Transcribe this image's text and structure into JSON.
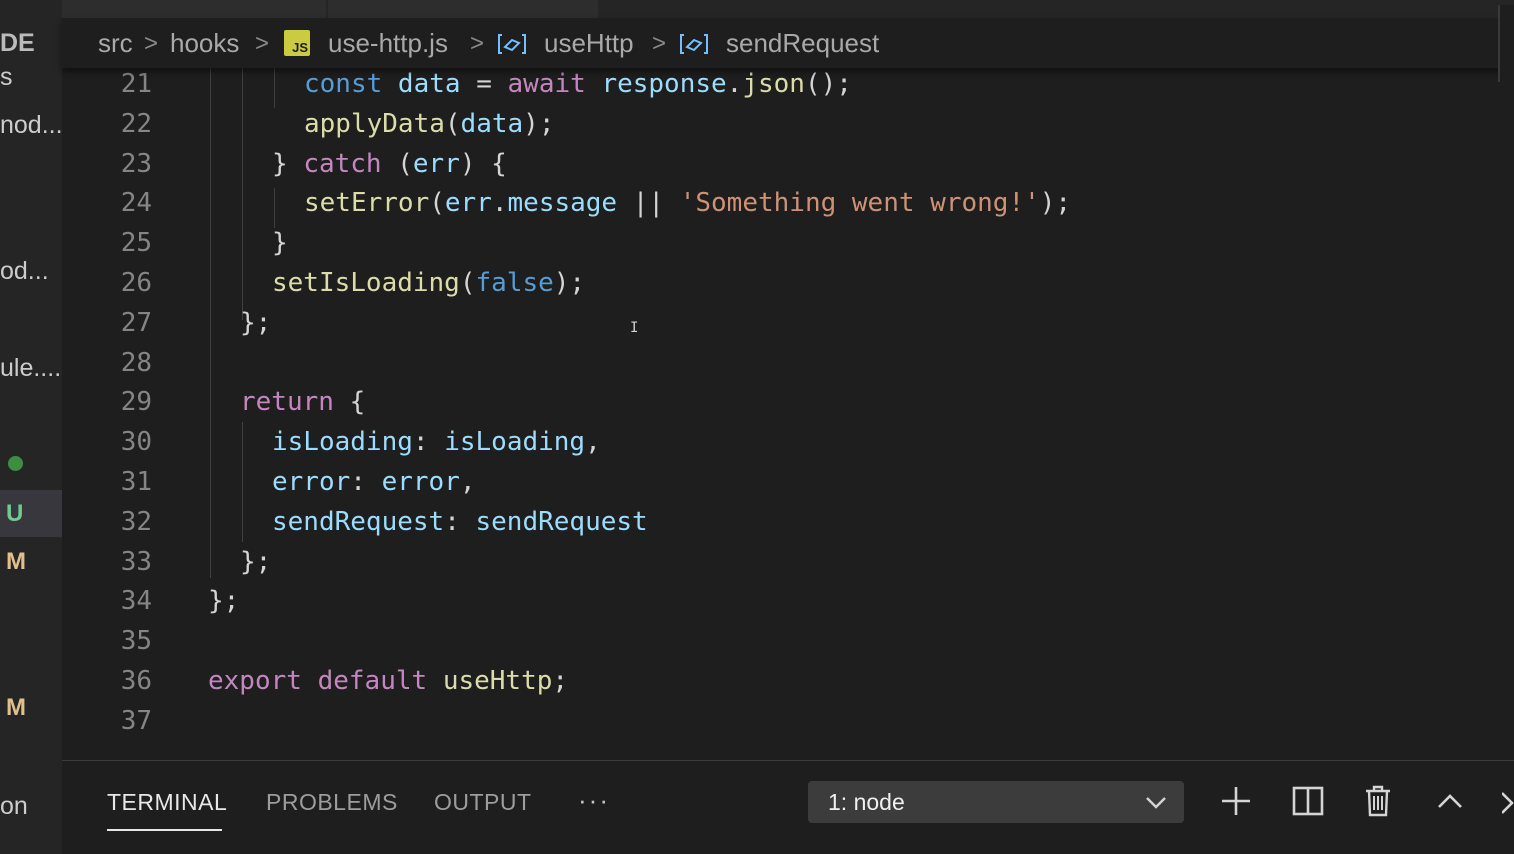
{
  "sidebar": {
    "title": "DE",
    "items": [
      {
        "text": "s"
      },
      {
        "text": "nod..."
      },
      {
        "text": "od..."
      },
      {
        "text": "ule...."
      },
      {
        "text": "on"
      }
    ],
    "badges": [
      "U",
      "M",
      "M"
    ]
  },
  "breadcrumb": {
    "items": [
      "src",
      "hooks",
      "use-http.js",
      "useHttp",
      "sendRequest"
    ],
    "file_icon_text": "JS",
    "separator": ">"
  },
  "editor": {
    "lines": [
      {
        "n": "21",
        "indent": 3,
        "tokens": [
          [
            "k-stor",
            "const "
          ],
          [
            "k-var",
            "data"
          ],
          [
            "k-punc",
            " = "
          ],
          [
            "k-ctrl",
            "await "
          ],
          [
            "k-var",
            "response"
          ],
          [
            "k-punc",
            "."
          ],
          [
            "k-fn",
            "json"
          ],
          [
            "k-punc",
            "();"
          ]
        ]
      },
      {
        "n": "22",
        "indent": 3,
        "tokens": [
          [
            "k-fn",
            "applyData"
          ],
          [
            "k-punc",
            "("
          ],
          [
            "k-var",
            "data"
          ],
          [
            "k-punc",
            ");"
          ]
        ]
      },
      {
        "n": "23",
        "indent": 2,
        "tokens": [
          [
            "k-punc",
            "} "
          ],
          [
            "k-ctrl",
            "catch"
          ],
          [
            "k-punc",
            " ("
          ],
          [
            "k-var",
            "err"
          ],
          [
            "k-punc",
            ") {"
          ]
        ]
      },
      {
        "n": "24",
        "indent": 3,
        "tokens": [
          [
            "k-fn",
            "setError"
          ],
          [
            "k-punc",
            "("
          ],
          [
            "k-var",
            "err"
          ],
          [
            "k-punc",
            "."
          ],
          [
            "k-var",
            "message"
          ],
          [
            "k-punc",
            " || "
          ],
          [
            "k-str",
            "'Something went wrong!'"
          ],
          [
            "k-punc",
            ");"
          ]
        ]
      },
      {
        "n": "25",
        "indent": 2,
        "tokens": [
          [
            "k-punc",
            "}"
          ]
        ]
      },
      {
        "n": "26",
        "indent": 2,
        "tokens": [
          [
            "k-fn",
            "setIsLoading"
          ],
          [
            "k-punc",
            "("
          ],
          [
            "k-stor",
            "false"
          ],
          [
            "k-punc",
            ");"
          ]
        ]
      },
      {
        "n": "27",
        "indent": 1,
        "tokens": [
          [
            "k-punc",
            "};"
          ]
        ]
      },
      {
        "n": "28",
        "indent": 0,
        "tokens": []
      },
      {
        "n": "29",
        "indent": 1,
        "tokens": [
          [
            "k-ctrl",
            "return"
          ],
          [
            "k-punc",
            " {"
          ]
        ]
      },
      {
        "n": "30",
        "indent": 2,
        "tokens": [
          [
            "k-var",
            "isLoading"
          ],
          [
            "k-punc",
            ": "
          ],
          [
            "k-var",
            "isLoading"
          ],
          [
            "k-punc",
            ","
          ]
        ]
      },
      {
        "n": "31",
        "indent": 2,
        "tokens": [
          [
            "k-var",
            "error"
          ],
          [
            "k-punc",
            ": "
          ],
          [
            "k-var",
            "error"
          ],
          [
            "k-punc",
            ","
          ]
        ]
      },
      {
        "n": "32",
        "indent": 2,
        "tokens": [
          [
            "k-var",
            "sendRequest"
          ],
          [
            "k-punc",
            ": "
          ],
          [
            "k-var",
            "sendRequest"
          ]
        ]
      },
      {
        "n": "33",
        "indent": 1,
        "tokens": [
          [
            "k-punc",
            "};"
          ]
        ]
      },
      {
        "n": "34",
        "indent": 0,
        "tokens": [
          [
            "k-punc",
            "};"
          ]
        ]
      },
      {
        "n": "35",
        "indent": 0,
        "tokens": []
      },
      {
        "n": "36",
        "indent": 0,
        "tokens": [
          [
            "k-ctrl",
            "export "
          ],
          [
            "k-ctrl",
            "default "
          ],
          [
            "k-fn",
            "useHttp"
          ],
          [
            "k-punc",
            ";"
          ]
        ]
      },
      {
        "n": "37",
        "indent": 0,
        "tokens": []
      }
    ]
  },
  "panel": {
    "tabs": [
      {
        "label": "TERMINAL",
        "active": true
      },
      {
        "label": "PROBLEMS",
        "active": false
      },
      {
        "label": "OUTPUT",
        "active": false
      }
    ],
    "more_label": "···",
    "terminal_select": "1: node",
    "actions": [
      "plus-icon",
      "split-icon",
      "trash-icon",
      "chevron-up-icon",
      "close-icon"
    ]
  },
  "colors": {
    "background": "#1e1e1e",
    "keyword_control": "#c586c0",
    "keyword_storage": "#569cd6",
    "variable": "#9cdcfe",
    "function": "#dcdcaa",
    "string": "#ce9178"
  }
}
